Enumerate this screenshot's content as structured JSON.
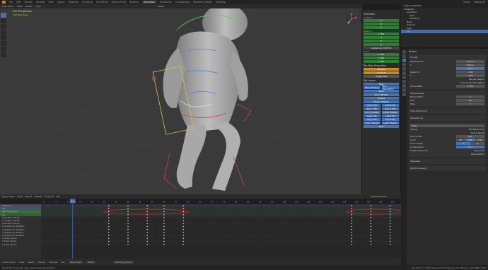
{
  "topbar": {
    "menus": [
      "File",
      "Edit",
      "Render",
      "Window",
      "Help"
    ],
    "workspaces": [
      "Layout",
      "Modeling",
      "Sculpting",
      "UV Editing",
      "Texture Paint",
      "Shading",
      "Animation",
      "Rendering",
      "Compositing",
      "Geometry Nodes",
      "Scripting"
    ],
    "active_workspace": "Animation",
    "scene_label": "Scene",
    "viewlayer_label": "ViewLayer"
  },
  "viewport": {
    "mode": "Pose Mode",
    "menus": [
      "View",
      "Select",
      "Pose"
    ],
    "transform": "Global",
    "overlay_title": "User Perspective",
    "overlay_sub": "(12) Bag_Base"
  },
  "npanel": {
    "transform_title": "Transform",
    "location_label": "Location:",
    "rotation_label": "Rotation:",
    "mode": "Quaternion (WXYZ)",
    "scale_label": "Scale:",
    "loc_values": [
      "0",
      "0",
      "0"
    ],
    "rot_values": [
      "1.000",
      "0",
      "0",
      "0"
    ],
    "scale_values": [
      "1.000",
      "1.000",
      "1.000"
    ],
    "rig_main_title": "Rig Main Properties",
    "rig_layers_title": "Rig Layers",
    "layers": [
      [
        "Face"
      ],
      [
        "Face (Primary)",
        "Face (Secondary)"
      ],
      [
        "Torso"
      ],
      [
        "Torso (Tweak)"
      ],
      [
        "Fingers"
      ],
      [
        "Fingers (Detail)"
      ],
      [
        "Arm.L (IK)",
        "Arm.R (IK)"
      ],
      [
        "Arm.L (FK)",
        "Arm.R (FK)"
      ],
      [
        "Arm.L (Tweak)",
        "Arm.R (Tweak)"
      ],
      [
        "Leg.L (IK)",
        "Leg.R (IK)"
      ],
      [
        "Leg.L (FK)",
        "Leg.R (FK)"
      ],
      [
        "Leg.L (Tweak)",
        "Leg.R (Tweak)"
      ],
      [
        "Root"
      ]
    ],
    "buttons": [
      "Snap IK",
      "Snap FK",
      "Toggle Pole"
    ]
  },
  "outliner": {
    "title": "Scene Collection",
    "rows": [
      "Collection",
      "Armature",
      "Pose",
      "Armature",
      "Body",
      "Camera",
      "Light",
      "rig"
    ]
  },
  "properties": {
    "output_title": "Output",
    "format_title": "Format",
    "resolution_x_label": "Resolution X",
    "resolution_x": "1920 px",
    "resolution_y_label": "Y",
    "resolution_y": "1080 px",
    "percent": "100%",
    "aspect_x_label": "Aspect X",
    "aspect_x": "1.000",
    "aspect_y_label": "Y",
    "aspect_y": "1.000",
    "render_region": "Render Region",
    "crop": "Crop to Render Region",
    "frame_rate_label": "Frame Rate",
    "frame_rate": "24 fps",
    "frame_range_title": "Frame Range",
    "frame_start_label": "Frame Start",
    "frame_start": "1",
    "end_label": "End",
    "end": "250",
    "step_label": "Step",
    "step": "1",
    "time_stretching": "Time Stretching",
    "stereoscopy": "Stereoscopy",
    "output_path": "/tmp/",
    "saving_label": "Saving",
    "file_extensions": "File Extensions",
    "cache_result": "Cache Result",
    "file_format_label": "File Format",
    "file_format": "PNG",
    "color_label": "Color",
    "color_opts": [
      "BW",
      "RGB",
      "RGBA"
    ],
    "color_depth_label": "Color Depth",
    "color_depth": [
      "8",
      "16"
    ],
    "compression_label": "Compression",
    "compression": "15%",
    "image_sequence_label": "Image Sequence",
    "overwrite": "Overwrite",
    "placeholders": "Placeholders",
    "metadata": "Metadata",
    "post_processing": "Post Processing"
  },
  "dopesheet": {
    "mode": "Dope Sheet",
    "menus": [
      "View",
      "Select",
      "Marker",
      "Channel",
      "Key"
    ],
    "ticks": [
      "0",
      "5",
      "10",
      "15",
      "20",
      "25",
      "30",
      "35",
      "40",
      "45",
      "50",
      "55",
      "60",
      "65",
      "70",
      "75",
      "80",
      "85",
      "90",
      "95",
      "100",
      "105",
      "110",
      "115",
      "120",
      "125",
      "130",
      "135",
      "140",
      "145"
    ],
    "current_frame": "12",
    "channels": [
      "Summary",
      "rig",
      "Running_Action",
      "rig",
      "X Location (Torso)",
      "Y Location (Torso)",
      "Z Location (Torso)",
      "W Quaternion Rotation",
      "X Quaternion Rotation",
      "Y Quaternion Rotation",
      "Z Quaternion Rotation",
      "X Scale (Torso)",
      "Y Scale (Torso)",
      "Z Scale (Torso)"
    ],
    "keyframes_a": [
      27,
      35,
      43,
      50,
      58
    ],
    "keyframes_b": [
      128,
      136,
      144,
      152,
      160
    ]
  },
  "actionbar": {
    "mode": "Action Editor",
    "menus": [
      "View",
      "Select",
      "Marker",
      "Channel",
      "Key"
    ],
    "push_down": "Push Down",
    "stash": "Stash",
    "action_name": "Running_Action",
    "playback": "Playback",
    "keying": "Keying",
    "view": "View",
    "marker": "Marker",
    "nearest_frame": "Nearest Frame"
  },
  "statusbar": {
    "left": "Select   Box Select   Pan View   Dope Sheet Context Menu",
    "right": "rig | Verts 0 / 7,462 | Bones 1/154 | Objects 1/6 | Memory: 102.6 MiB | 3.0.0"
  },
  "colors": {
    "accent": "#4772b3",
    "field_green": "#2e7d32",
    "workspace_active": "#3a3a3a",
    "annotation_red": "#d02020"
  }
}
